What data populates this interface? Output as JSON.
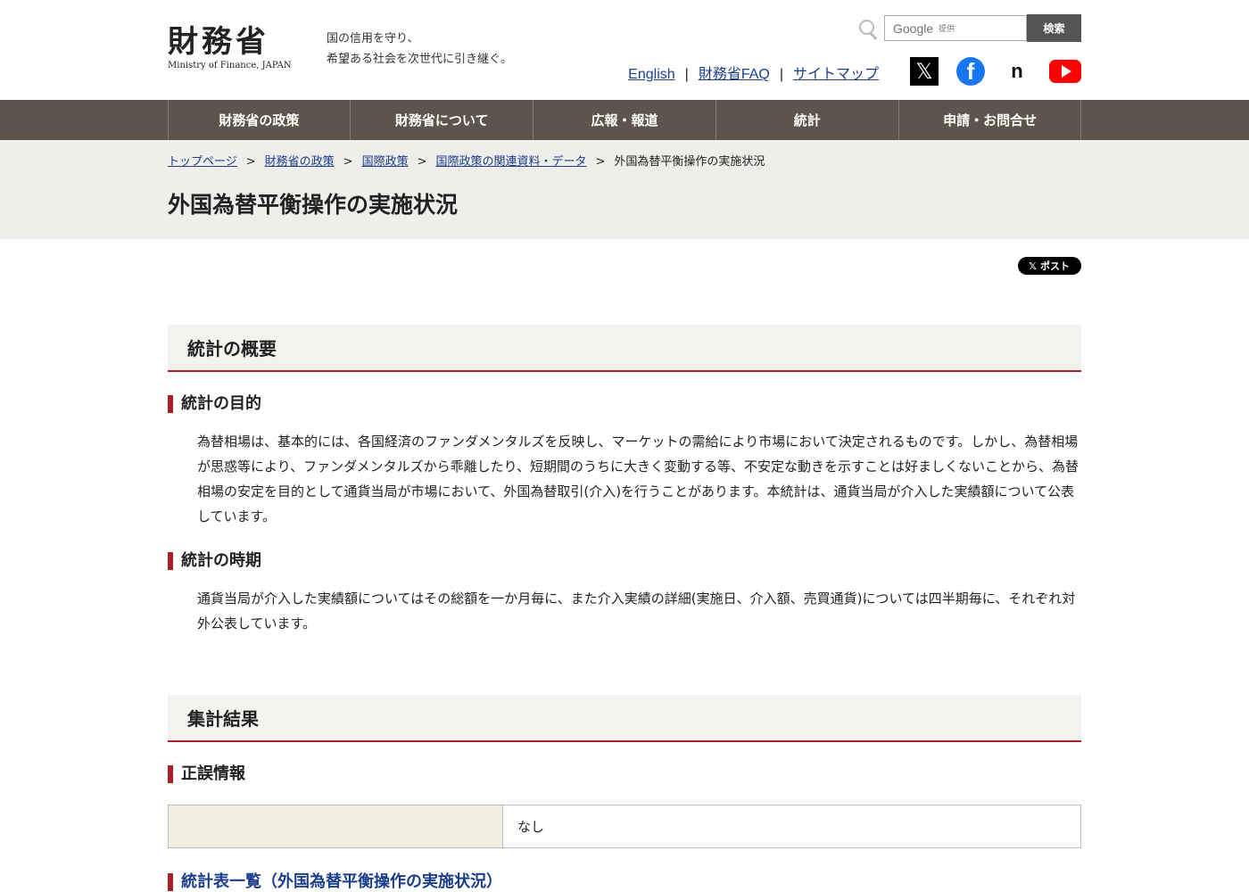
{
  "header": {
    "logo_jp": "財務省",
    "logo_en": "Ministry of Finance, JAPAN",
    "tagline_1": "国の信用を守り、",
    "tagline_2": "希望ある社会を次世代に引き継ぐ。",
    "search_brand": "Google",
    "search_brand_sub": "提供",
    "search_button": "検索",
    "links": [
      "English",
      "財務省FAQ",
      "サイトマップ"
    ],
    "separator": "|",
    "social": [
      {
        "icon": "x-icon"
      },
      {
        "icon": "facebook-icon"
      },
      {
        "icon": "note-icon"
      },
      {
        "icon": "youtube-icon"
      }
    ],
    "x_glyph": "𝕏",
    "fb_glyph": "f",
    "note_glyph": "n"
  },
  "nav": {
    "items": [
      "財務省の政策",
      "財務省について",
      "広報・報道",
      "統計",
      "申請・お問合せ"
    ]
  },
  "breadcrumb": {
    "items": [
      "トップページ",
      "財務省の政策",
      "国際政策",
      "国際政策の関連資料・データ"
    ],
    "current": "外国為替平衡操作の実施状況",
    "separator": ">"
  },
  "page": {
    "title": "外国為替平衡操作の実施状況",
    "post_label": "ポスト",
    "post_x": "𝕏"
  },
  "section1": {
    "title": "統計の概要",
    "purpose_heading": "統計の目的",
    "purpose_text": "為替相場は、基本的には、各国経済のファンダメンタルズを反映し、マーケットの需給により市場において決定されるものです。しかし、為替相場が思惑等により、ファンダメンタルズから乖離したり、短期間のうちに大きく変動する等、不安定な動きを示すことは好ましくないことから、為替相場の安定を目的として通貨当局が市場において、外国為替取引(介入)を行うことがあります。本統計は、通貨当局が介入した実績額について公表しています。",
    "timing_heading": "統計の時期",
    "timing_text": "通貨当局が介入した実績額についてはその総額を一か月毎に、また介入実績の詳細(実施日、介入額、売買通貨)については四半期毎に、それぞれ対外公表しています。"
  },
  "section2": {
    "title": "集計結果",
    "errata_heading": "正誤情報",
    "errata_value": "なし",
    "table_heading": "統計表一覧（外国為替平衡操作の実施状況）"
  },
  "colors": {
    "nav_bg": "#5d554b",
    "accent_red": "#a8212b",
    "link_blue": "#1a3e8c",
    "band_bg": "#efeeeb"
  }
}
